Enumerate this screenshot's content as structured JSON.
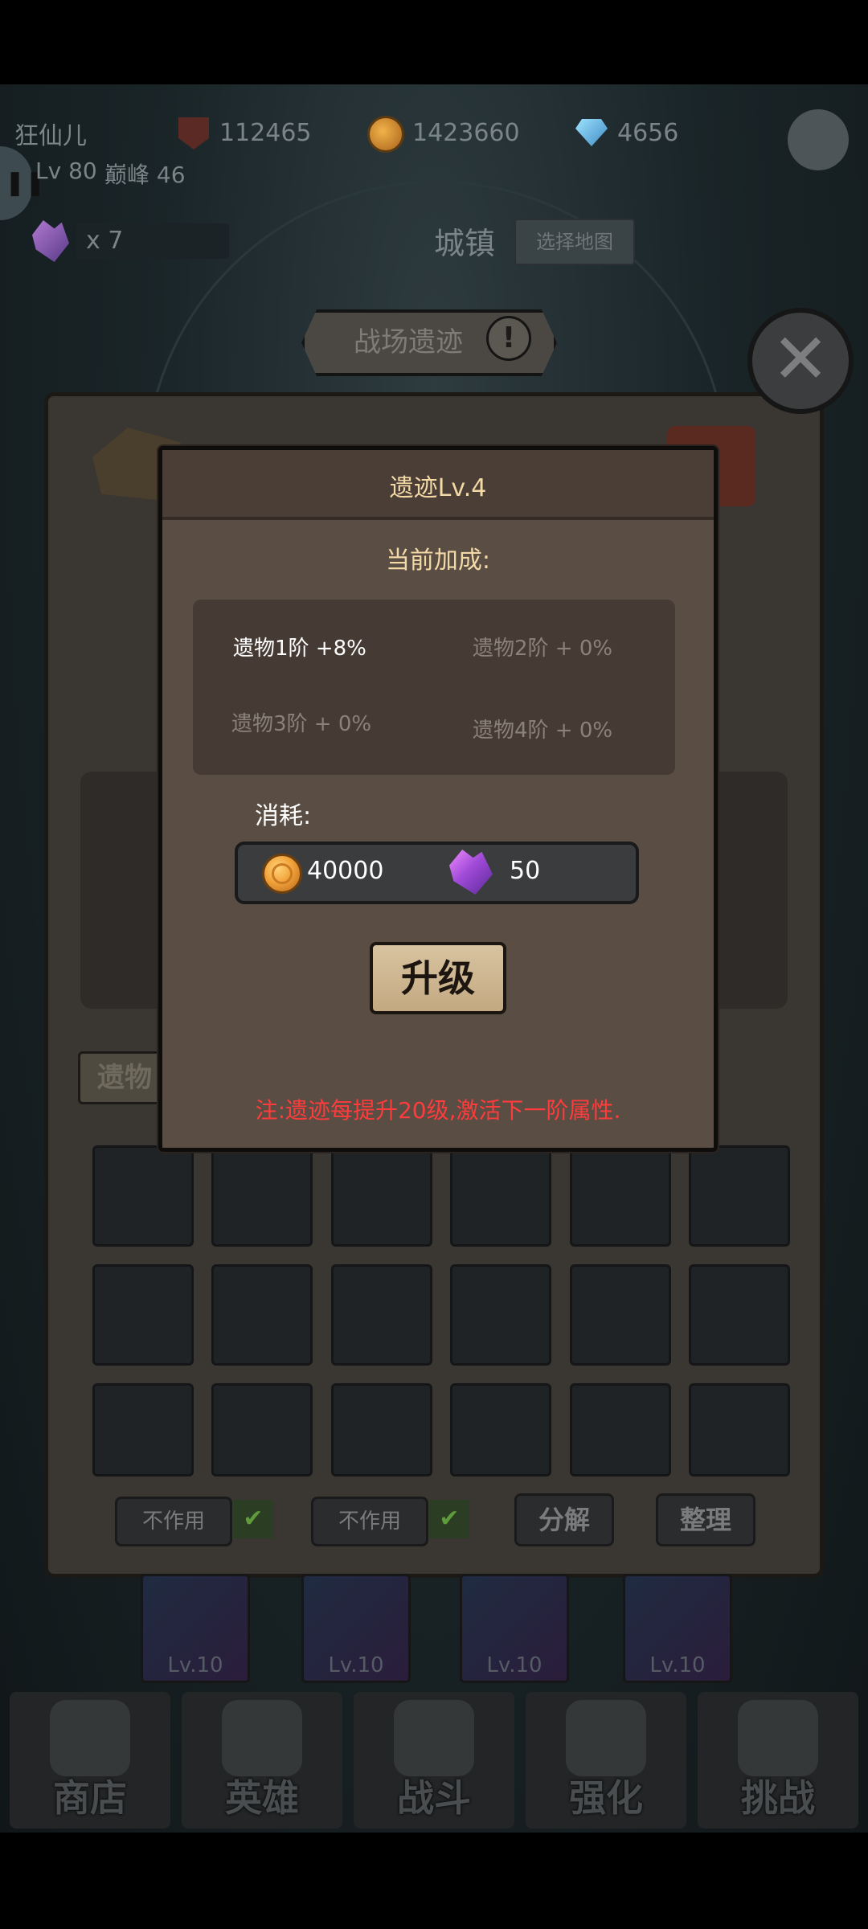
{
  "header": {
    "player_name": "狂仙儿",
    "level_text": "Lv 80",
    "peak_text": "巅峰 46",
    "power": "112465",
    "gold": "1423660",
    "diamonds": "4656",
    "crystal_count": "x 7",
    "location": "城镇",
    "select_map": "选择地图"
  },
  "panel": {
    "title": "战场遗迹",
    "tab_relic": "遗物",
    "toggle1_label": "不作用",
    "toggle2_label": "不作用",
    "decompose_label": "分解",
    "organize_label": "整理"
  },
  "skills": [
    "Lv.10",
    "Lv.10",
    "Lv.10",
    "Lv.10"
  ],
  "nav": {
    "shop": "商店",
    "hero": "英雄",
    "battle": "战斗",
    "enhance": "强化",
    "challenge": "挑战"
  },
  "popup": {
    "title": "遗迹Lv.4",
    "bonus_label": "当前加成:",
    "bonuses": [
      {
        "text": "遗物1阶 +8%",
        "active": true
      },
      {
        "text": "遗物2阶 + 0%",
        "active": false
      },
      {
        "text": "遗物3阶 + 0%",
        "active": false
      },
      {
        "text": "遗物4阶 + 0%",
        "active": false
      }
    ],
    "cost_label": "消耗:",
    "cost_gold": "40000",
    "cost_crystal": "50",
    "upgrade_label": "升级",
    "note": "注:遗迹每提升20级,激活下一阶属性."
  },
  "colors": {
    "popup_bg": "#5a4d44",
    "title_gold": "#f3d9a6",
    "note_red": "#ff3b3b"
  }
}
